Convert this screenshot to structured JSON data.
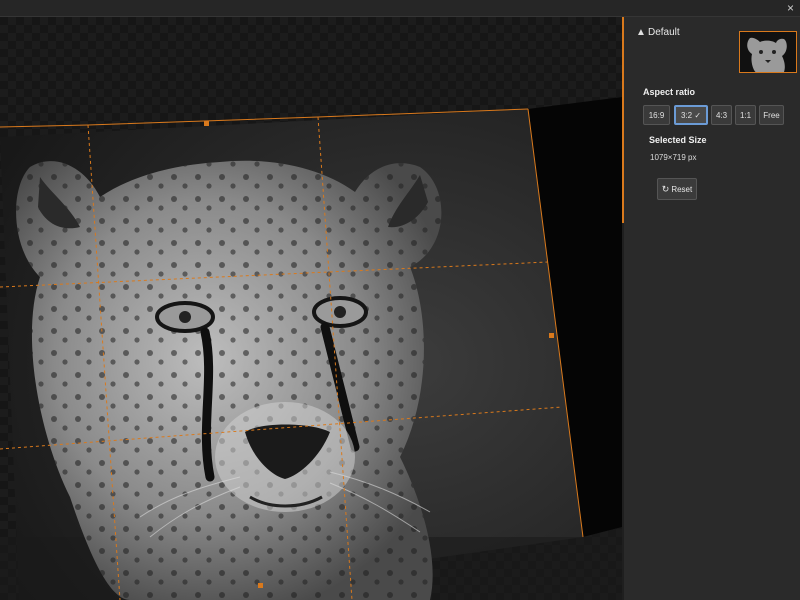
{
  "window": {
    "close_label": "×"
  },
  "panel": {
    "header_title": "Default",
    "aspect_ratio_label": "Aspect ratio",
    "ratios": [
      {
        "label": "16:9",
        "active": false
      },
      {
        "label": "3:2 ✓",
        "active": true
      },
      {
        "label": "4:3",
        "active": false
      },
      {
        "label": "1:1",
        "active": false
      },
      {
        "label": "Free",
        "active": false
      }
    ],
    "selected_size_label": "Selected Size",
    "selected_size_value": "1079×719 px",
    "reset_label": "Reset",
    "reset_icon": "↻"
  },
  "colors": {
    "accent": "#d9791c",
    "active_border": "#6b9bd6"
  }
}
